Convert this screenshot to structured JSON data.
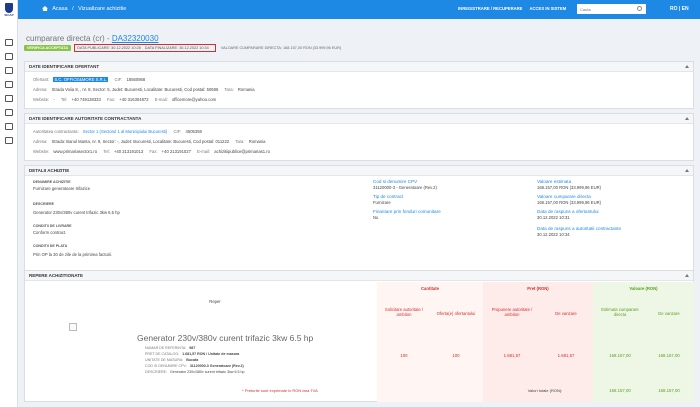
{
  "header": {
    "logo_label": "SICAP",
    "breadcrumbs": [
      "Acasa",
      "/",
      "Vizualizare achizitie"
    ],
    "links": [
      "INREGISTRARE / RECUPERARE",
      "ACCES IN SISTEM"
    ],
    "search_placeholder": "Cauta",
    "lang": "RO | EN"
  },
  "title": {
    "prefix": "cumparare directa (cr) -",
    "code": "DA32320030"
  },
  "status": {
    "badge": "VERIFICA ACCEPTATA",
    "data_publicare": "DATA PUBLICARE: 30.12.2022 10:28",
    "data_finalizare": "DATA FINALIZARE: 30.12.2022 10:34",
    "valoare": "VALOARE CUMPARARE DIRECTA: 168.157,00 RON (33.999,96 EUR)"
  },
  "ofertant": {
    "heading": "DATE IDENTIFICARE OFERTANT",
    "ofertant_label": "Ofertant:",
    "ofertant_name": "S.C. OFFICE&MORE S.R.L.",
    "cif_label": "CIF:",
    "cif": "18560868",
    "adresa_label": "Adresa:",
    "adresa": "Strada Voiia 8, , nr. 8, Sector: 5, Judet: Bucuresti, Localitate: Bucuresti, Cod postal: 50686",
    "tara_label": "Tara:",
    "tara": "Romania",
    "website_label": "Website:",
    "website": "-",
    "tel_label": "Tel:",
    "tel": "+40 749138333",
    "fax_label": "Fax:",
    "fax": "+40 316304872",
    "email_label": "E-mail:",
    "email": "officemore@yahoo.com"
  },
  "autoritate": {
    "heading": "DATE IDENTIFICARE AUTORITATE CONTRACTANTA",
    "aut_label": "Autoritatea contractanta:",
    "aut_name": "Sector 1 (Sectorul 1 al Municipiului Bucuresti)",
    "cif_label": "CIF:",
    "cif": "4505359",
    "adresa_label": "Adresa:",
    "adresa": "Strada: Banul Manta, nr. 9, Sector: -, Judet: Bucuresti, Localitate: Bucuresti, Cod postal: 011222",
    "tara_label": "Tara:",
    "tara": "Romania",
    "website_label": "Website:",
    "website": "www.primariasector1.ro",
    "tel_label": "Tel:",
    "tel": "+40 213191013",
    "fax_label": "Fax:",
    "fax": "+40 213191027",
    "email_label": "E-mail:",
    "email": "achizitiipublice@primarias1.ro"
  },
  "detalii": {
    "heading": "DETALII ACHIZITIE",
    "denumire_label": "DENUMIRE ACHIZITIE",
    "denumire": "Furnizare generatoare trifazice",
    "descriere_label": "DESCRIERE",
    "descriere": "Generator 230v/380v curent trifazic 3kw 6.5 hp",
    "conditii_livrare_label": "CONDITII DE LIVRARE",
    "conditii_livrare": "Conform contract.",
    "conditii_plata_label": "CONDITII DE PLATA",
    "conditii_plata": "Prin OP la 30 de zile de la primirea facturii.",
    "cod_cpv_label": "Cod si denumire CPV",
    "cod_cpv": "31120000-3 - Generatoare (Rev.2)",
    "tip_contract_label": "Tip de contract",
    "tip_contract": "Furnizare",
    "fonduri_label": "Finantare prin fonduri comunitare",
    "fonduri": "Nu",
    "valoare_estimata_label": "Valoare estimata",
    "valoare_estimata": "168.157,00 RON (33.999,96 EUR)",
    "valoare_cumparare_label": "Valoare cumparare directa",
    "valoare_cumparare": "168.157,00 RON (33.999,96 EUR)",
    "data_raspuns_label": "Data de raspuns a ofertantului",
    "data_raspuns": "30.12.2022 10:31",
    "data_aprobare_label": "Data de raspuns a autoritatii contractante",
    "data_aprobare": "30.12.2022 10:34"
  },
  "repere": {
    "heading": "REPERE ACHIZITIONATE",
    "col_reper": "Reper",
    "col_cantitate": "Cantitate",
    "col_pret": "Pret (RON)",
    "col_valoare": "Valoare (RON)",
    "sub_solicitare": "Solicitare autoritate / ambiton",
    "sub_oferta": "Oferta(e) ofertantului",
    "sub_propunere": "Propunere autoritate / ambiton",
    "sub_vanzare": "De vanzare",
    "sub_estimata": "Estimata cumparare directa",
    "sub_vanzare2": "De vanzare",
    "item_title": "Generator 230v/380v curent trifazic 3kw 6.5 hp",
    "numar_label": "NUMAR DE REFERINTA:",
    "numar": "987",
    "pret_catalog_label": "PRET DE CATALOG:",
    "pret_catalog": "1.681,57 RON / Unitate de masura",
    "unitate_label": "UNITATE DE MASURA:",
    "unitate": "Bucata",
    "cpv_label": "COD SI DENUMIRE CPV:",
    "cpv": "31120000-3 Generatoare (Rev.2)",
    "descriere_label": "DESCRIERE:",
    "descriere": "Generator 230v/380v curent trifazic 3kw 6.5 hp",
    "qty_solicitare": "100",
    "qty_oferta": "100",
    "pret_propunere": "1.681,57",
    "pret_vanzare": "1.681,57",
    "val_estimata": "168.157,00",
    "val_vanzare": "168.157,00",
    "footnote": "* Preturile sunt exprimate in RON fara TVA",
    "total_label": "Valori totale (RON):",
    "total_estimata": "168.157,00",
    "total_vanzare": "168.157,00"
  },
  "colors": {
    "accent": "#1e88e5",
    "green": "#8bc34a",
    "red": "#d32f2f"
  }
}
